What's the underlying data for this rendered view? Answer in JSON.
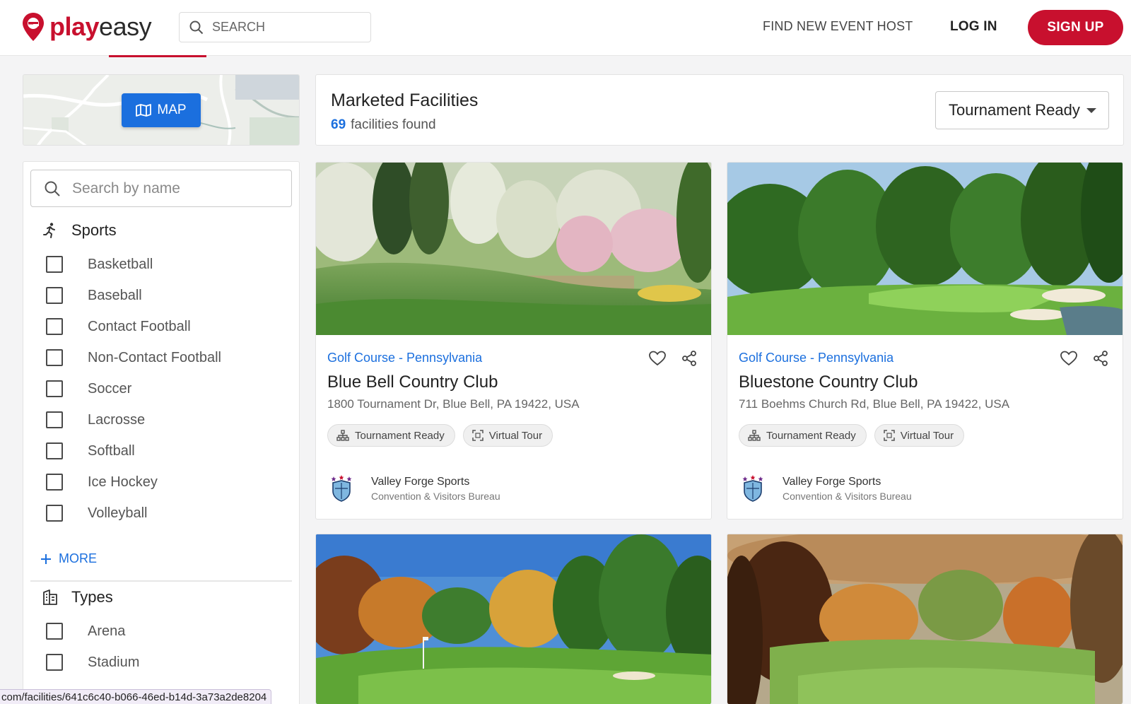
{
  "header": {
    "logo_play": "play",
    "logo_easy": "easy",
    "search_placeholder": "SEARCH",
    "find_host": "FIND NEW EVENT HOST",
    "login": "LOG IN",
    "signup": "SIGN UP"
  },
  "map": {
    "button_label": "MAP",
    "icon": "map-icon"
  },
  "sidebar": {
    "search_placeholder": "Search by name",
    "sports": {
      "title": "Sports",
      "icon": "running-person-icon",
      "items": [
        "Basketball",
        "Baseball",
        "Contact Football",
        "Non-Contact Football",
        "Soccer",
        "Lacrosse",
        "Softball",
        "Ice Hockey",
        "Volleyball"
      ]
    },
    "more_label": "MORE",
    "types": {
      "title": "Types",
      "icon": "building-icon",
      "items": [
        "Arena",
        "Stadium"
      ]
    }
  },
  "results": {
    "title": "Marketed Facilities",
    "count": "69",
    "count_label": "facilities found",
    "sort_selected": "Tournament Ready"
  },
  "cards": [
    {
      "category": "Golf Course - Pennsylvania",
      "name": "Blue Bell Country Club",
      "address": "1800 Tournament Dr, Blue Bell, PA 19422, USA",
      "tags": [
        "Tournament Ready",
        "Virtual Tour"
      ],
      "owner_name": "Valley Forge Sports",
      "owner_sub": "Convention & Visitors Bureau"
    },
    {
      "category": "Golf Course - Pennsylvania",
      "name": "Bluestone Country Club",
      "address": "711 Boehms Church Rd, Blue Bell, PA 19422, USA",
      "tags": [
        "Tournament Ready",
        "Virtual Tour"
      ],
      "owner_name": "Valley Forge Sports",
      "owner_sub": "Convention & Visitors Bureau"
    }
  ],
  "status_url": "com/facilities/641c6c40-b066-46ed-b14d-3a73a2de8204",
  "colors": {
    "brand": "#c8102e",
    "accent": "#1b6fde"
  }
}
